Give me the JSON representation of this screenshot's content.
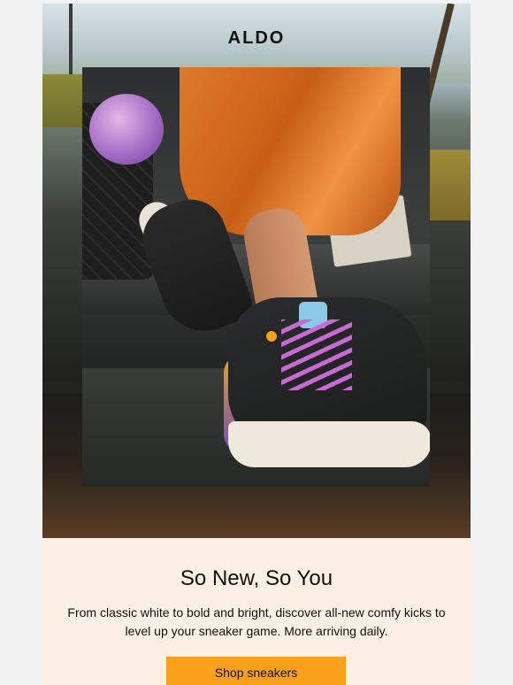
{
  "email": {
    "brand_logo": "ALDO",
    "headline": "So New, So You",
    "body": "From classic white to bold and bright, discover all-new comfy kicks to level up your sneaker game. More arriving daily.",
    "cta_label": "Shop sneakers"
  },
  "colors": {
    "page_background": "#f2f2f2",
    "content_background": "#fcefe4",
    "cta_background": "#f9a11b",
    "text": "#111111"
  },
  "hero_image": {
    "alt": "hero-photo-sneakers"
  }
}
